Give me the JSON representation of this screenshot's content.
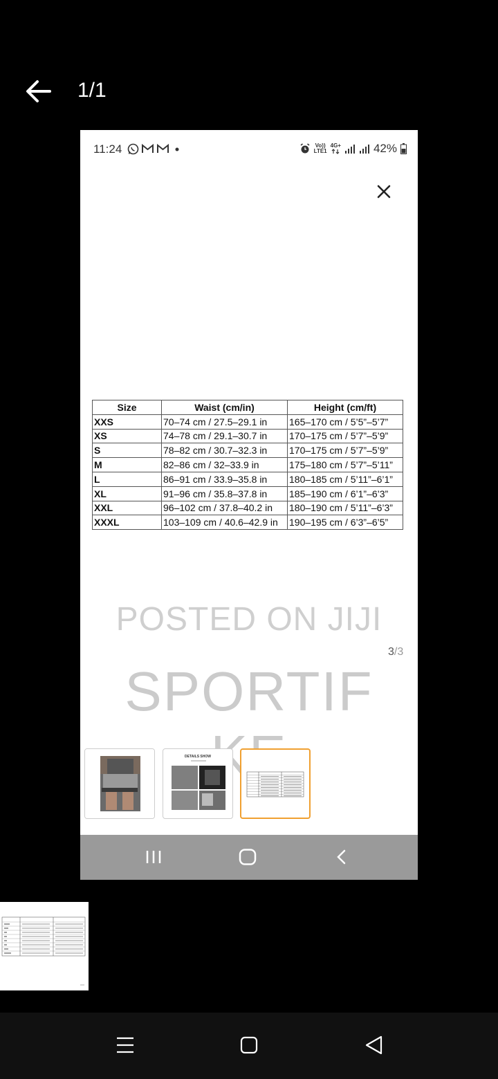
{
  "viewer": {
    "counter": "1/1",
    "icons": {
      "back": "arrow-left-icon"
    }
  },
  "image": {
    "status_bar": {
      "time": "11:24",
      "volte_top": "Vo))",
      "volte_bottom": "LTE1",
      "net_top": "4G+",
      "battery": "42%"
    },
    "table": {
      "headers": [
        "Size",
        "Waist (cm/in)",
        "Height (cm/ft)"
      ],
      "rows": [
        [
          "XXS",
          "70–74 cm / 27.5–29.1 in",
          "165–170 cm / 5’5”–5’7”"
        ],
        [
          "XS",
          "74–78 cm / 29.1–30.7 in",
          "170–175 cm / 5’7”–5’9”"
        ],
        [
          "S",
          "78–82 cm / 30.7–32.3 in",
          "170–175 cm / 5’7”–5’9”"
        ],
        [
          "M",
          "82–86 cm / 32–33.9 in",
          "175–180 cm / 5’7”–5’11”"
        ],
        [
          "L",
          "86–91 cm / 33.9–35.8 in",
          "180–185 cm / 5’11”–6’1”"
        ],
        [
          "XL",
          "91–96 cm / 35.8–37.8 in",
          "185–190 cm / 6’1”–6’3”"
        ],
        [
          "XXL",
          "96–102 cm / 37.8–40.2 in",
          "180–190 cm / 5’11”–6’3”"
        ],
        [
          "XXXL",
          "103–109 cm / 40.6–42.9 in",
          "190–195 cm / 6’3”–6’5”"
        ]
      ]
    },
    "watermark_line1": "POSTED ON JIJI",
    "watermark_line2": "SPORTIF KE",
    "slide_current": "3",
    "slide_total": "/3",
    "thumb2_caption": "DETAILS SHOW"
  },
  "colors": {
    "background": "#000000",
    "active_thumb_border": "#f0a030",
    "inner_nav_bg": "#9a9a9a"
  }
}
